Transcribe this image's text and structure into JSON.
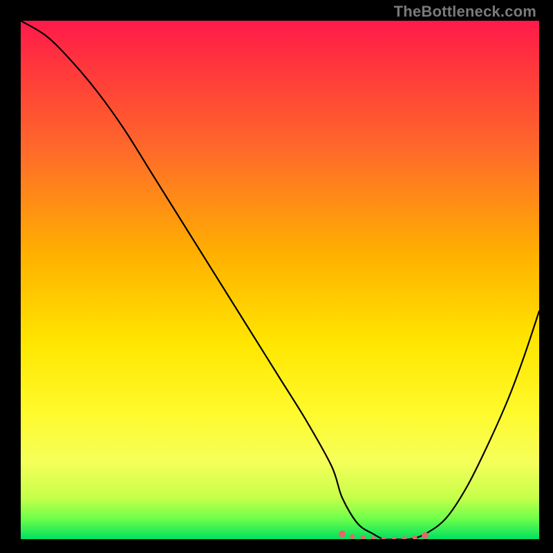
{
  "watermark": "TheBottleneck.com",
  "chart_data": {
    "type": "line",
    "title": "",
    "xlabel": "",
    "ylabel": "",
    "xlim": [
      0,
      100
    ],
    "ylim": [
      0,
      100
    ],
    "series": [
      {
        "name": "bottleneck-curve",
        "x": [
          0,
          5,
          10,
          15,
          20,
          25,
          30,
          35,
          40,
          45,
          50,
          55,
          60,
          62,
          65,
          68,
          70,
          72,
          75,
          78,
          82,
          86,
          90,
          94,
          97,
          100
        ],
        "y": [
          100,
          97,
          92,
          86,
          79,
          71,
          63,
          55,
          47,
          39,
          31,
          23,
          14,
          8,
          3,
          1,
          0,
          0,
          0,
          1,
          4,
          10,
          18,
          27,
          35,
          44
        ]
      },
      {
        "name": "flat-floor-markers",
        "x": [
          62,
          64,
          66,
          68,
          70,
          72,
          74,
          76,
          78
        ],
        "y": [
          1,
          0.5,
          0.3,
          0.1,
          0,
          0,
          0.1,
          0.3,
          0.7
        ]
      }
    ],
    "gradient_stops": [
      {
        "pos": 0,
        "color": "#ff1a4a"
      },
      {
        "pos": 10,
        "color": "#ff3a3a"
      },
      {
        "pos": 25,
        "color": "#ff6a2a"
      },
      {
        "pos": 45,
        "color": "#ffb000"
      },
      {
        "pos": 62,
        "color": "#ffe600"
      },
      {
        "pos": 75,
        "color": "#fff92a"
      },
      {
        "pos": 85,
        "color": "#f6ff5a"
      },
      {
        "pos": 92,
        "color": "#c6ff4a"
      },
      {
        "pos": 96,
        "color": "#6fff4a"
      },
      {
        "pos": 100,
        "color": "#00e060"
      }
    ],
    "marker_color": "#e06a6a",
    "curve_color": "#000000"
  }
}
